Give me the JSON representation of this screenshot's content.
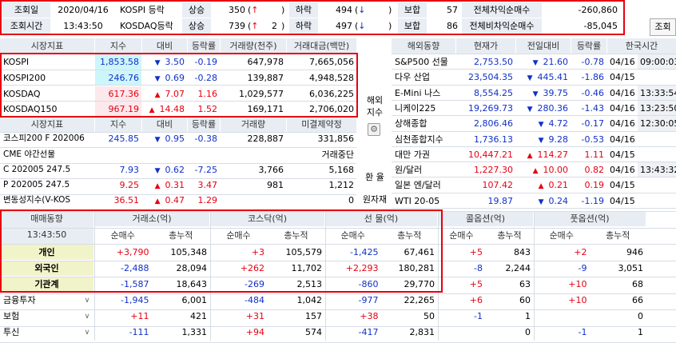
{
  "top": {
    "date_label": "조회일",
    "date_value": "2020/04/16",
    "time_label": "조회시간",
    "time_value": "13:43:50",
    "kospi": {
      "name": "KOSPI 등락",
      "up_label": "상승",
      "up_value": "350",
      "up_paren_l": "(",
      "up_arrow": "↑",
      "up_paren_r": ")",
      "down_label": "하락",
      "down_value": "494",
      "down_paren_l": "(",
      "down_arrow": "↓",
      "down_paren_r": ")",
      "flat_label": "보합",
      "flat_value": "57",
      "arb_label": "전체차익순매수",
      "arb_value": "-260,860"
    },
    "kosdaq": {
      "name": "KOSDAQ등락",
      "up_label": "상승",
      "up_value": "739",
      "up_paren_l": "(",
      "up_arrow": "↑",
      "up_count": "2",
      "up_paren_r": ")",
      "down_label": "하락",
      "down_value": "497",
      "down_paren_l": "(",
      "down_arrow": "↓",
      "down_paren_r": ")",
      "flat_label": "보합",
      "flat_value": "86",
      "arb_label": "전체비차익순매수",
      "arb_value": "-85,045"
    },
    "query_button": "조회"
  },
  "market": {
    "headers": [
      "시장지표",
      "지수",
      "대비",
      "등락률",
      "거래량(천주)",
      "거래대금(백만)"
    ],
    "rows": [
      {
        "name": "KOSPI",
        "index": "1,853.58",
        "dir": "▼",
        "change": "3.50",
        "rate": "-0.19",
        "volume": "647,978",
        "amount": "7,665,056"
      },
      {
        "name": "KOSPI200",
        "index": "246.76",
        "dir": "▼",
        "change": "0.69",
        "rate": "-0.28",
        "volume": "139,887",
        "amount": "4,948,528"
      },
      {
        "name": "KOSDAQ",
        "index": "617.36",
        "dir": "▲",
        "change": "7.07",
        "rate": "1.16",
        "volume": "1,029,577",
        "amount": "6,036,225"
      },
      {
        "name": "KOSDAQ150",
        "index": "967.19",
        "dir": "▲",
        "change": "14.48",
        "rate": "1.52",
        "volume": "169,171",
        "amount": "2,706,020"
      }
    ],
    "fut_headers": [
      "시장지표",
      "지수",
      "대비",
      "등락률",
      "거래량",
      "미결제약정"
    ],
    "fut_rows": [
      {
        "name": "코스피200 F 202006",
        "index": "245.85",
        "dir": "▼",
        "change": "0.95",
        "rate": "-0.38",
        "volume": "228,887",
        "oi": "331,856"
      },
      {
        "name": "CME 야간선물",
        "index": "",
        "dir": "",
        "change": "",
        "rate": "",
        "volume": "",
        "oi": "거래중단"
      },
      {
        "name": "C 202005 247.5",
        "index": "7.93",
        "dir": "▼",
        "change": "0.62",
        "rate": "-7.25",
        "volume": "3,766",
        "oi": "5,168"
      },
      {
        "name": "P 202005 247.5",
        "index": "9.25",
        "dir": "▲",
        "change": "0.31",
        "rate": "3.47",
        "volume": "981",
        "oi": "1,212"
      },
      {
        "name": "변동성지수(V-KOS",
        "index": "36.51",
        "dir": "▲",
        "change": "0.47",
        "rate": "1.29",
        "volume": "",
        "oi": "0"
      }
    ],
    "overseas_label": "해외\n지수",
    "fx_label_1": "환  율",
    "fx_label_2": "원자재"
  },
  "overseas": {
    "headers": [
      "해외동향",
      "현재가",
      "전일대비",
      "등락률",
      "한국시간"
    ],
    "rows": [
      {
        "name": "S&P500 선물",
        "price": "2,753.50",
        "dir": "▼",
        "change": "21.60",
        "rate": "-0.78",
        "date": "04/16",
        "time": "09:00:03"
      },
      {
        "name": "다우 산업",
        "price": "23,504.35",
        "dir": "▼",
        "change": "445.41",
        "rate": "-1.86",
        "date": "04/15",
        "time": ""
      },
      {
        "name": "E-Mini 나스",
        "price": "8,554.25",
        "dir": "▼",
        "change": "39.75",
        "rate": "-0.46",
        "date": "04/16",
        "time": "13:33:54"
      },
      {
        "name": "니케이225",
        "price": "19,269.73",
        "dir": "▼",
        "change": "280.36",
        "rate": "-1.43",
        "date": "04/16",
        "time": "13:23:50"
      },
      {
        "name": "상해종합",
        "price": "2,806.46",
        "dir": "▼",
        "change": "4.72",
        "rate": "-0.17",
        "date": "04/16",
        "time": "12:30:05"
      },
      {
        "name": "심천종합지수",
        "price": "1,736.13",
        "dir": "▼",
        "change": "9.28",
        "rate": "-0.53",
        "date": "04/16",
        "time": ""
      },
      {
        "name": "대만 가권",
        "price": "10,447.21",
        "dir": "▲",
        "change": "114.27",
        "rate": "1.11",
        "date": "04/15",
        "time": ""
      },
      {
        "name": "원/달러",
        "price": "1,227.30",
        "dir": "▲",
        "change": "10.00",
        "rate": "0.82",
        "date": "04/16",
        "time": "13:43:32"
      },
      {
        "name": "일본 엔/달러",
        "price": "107.42",
        "dir": "▲",
        "change": "0.21",
        "rate": "0.19",
        "date": "04/15",
        "time": ""
      },
      {
        "name": "WTI 20-05",
        "price": "19.87",
        "dir": "▼",
        "change": "0.24",
        "rate": "-1.19",
        "date": "04/15",
        "time": ""
      }
    ]
  },
  "trading": {
    "title": "매매동향",
    "time": "13:43:50",
    "groups": [
      "거래소(억)",
      "코스닥(억)",
      "선   물(억)",
      "콜옵션(억)",
      "풋옵션(억)"
    ],
    "sub": [
      "순매수",
      "총누적"
    ],
    "rows": [
      {
        "name": "개인",
        "vals": [
          "+3,790",
          "105,348",
          "+3",
          "105,579",
          "-1,425",
          "67,461",
          "+5",
          "843",
          "+2",
          "946"
        ]
      },
      {
        "name": "외국인",
        "vals": [
          "-2,488",
          "28,094",
          "+262",
          "11,702",
          "+2,293",
          "180,281",
          "-8",
          "2,244",
          "-9",
          "3,051"
        ]
      },
      {
        "name": "기관계",
        "vals": [
          "-1,587",
          "18,643",
          "-269",
          "2,513",
          "-860",
          "29,770",
          "+5",
          "63",
          "+10",
          "68"
        ]
      },
      {
        "name": "금융투자",
        "vals": [
          "-1,945",
          "6,001",
          "-484",
          "1,042",
          "-977",
          "22,265",
          "+6",
          "60",
          "+10",
          "66"
        ]
      },
      {
        "name": "보험",
        "vals": [
          "+11",
          "421",
          "+31",
          "157",
          "+38",
          "50",
          "-1",
          "1",
          "",
          "0"
        ]
      },
      {
        "name": "투신",
        "vals": [
          "-111",
          "1,331",
          "+94",
          "574",
          "-417",
          "2,831",
          "",
          "0",
          "-1",
          "1"
        ]
      }
    ]
  },
  "colors": {
    "up": "#e60012",
    "down": "#1030c8",
    "header_bg": "#e8edf3",
    "highlight": "#cdf6fb",
    "box": "#e60012"
  }
}
